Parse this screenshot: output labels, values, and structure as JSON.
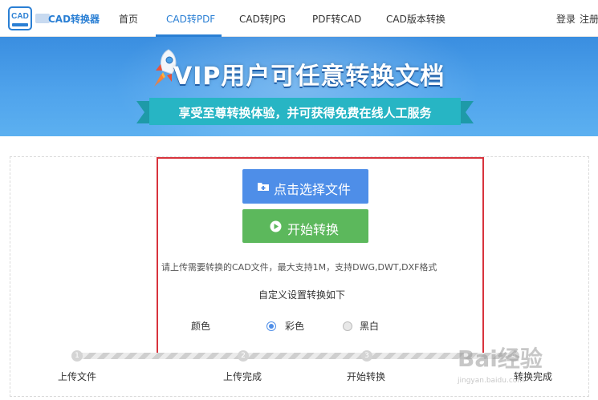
{
  "header": {
    "logo_icon_text": "CAD",
    "app_name": "CAD转换器",
    "nav": [
      {
        "label": "首页",
        "icon": "none"
      },
      {
        "label": "CAD转PDF",
        "active": true
      },
      {
        "label": "CAD转JPG"
      },
      {
        "label": "PDF转CAD"
      },
      {
        "label": "CAD版本转换"
      }
    ],
    "login": "登录",
    "register": "注册",
    "accent_color": "#2a7fd4"
  },
  "banner": {
    "title": "VIP用户可任意转换文档",
    "subtitle": "享受至尊转换体验，并可获得免费在线人工服务",
    "icon": "rocket-icon"
  },
  "upload": {
    "select_button": "点击选择文件",
    "select_icon": "folder-plus-icon",
    "convert_button": "开始转换",
    "convert_icon": "play-circle-icon",
    "hint": "请上传需要转换的CAD文件，最大支持1M，支持DWG,DWT,DXF格式",
    "settings_title": "自定义设置转换如下",
    "color_label": "颜色",
    "options": [
      {
        "label": "彩色",
        "checked": true
      },
      {
        "label": "黑白",
        "checked": false
      }
    ]
  },
  "steps": [
    {
      "num": "1",
      "label": "上传文件"
    },
    {
      "num": "2",
      "label": "上传完成"
    },
    {
      "num": "3",
      "label": "开始转换"
    },
    {
      "num": "4",
      "label": "转换完成"
    }
  ],
  "watermark": {
    "text": "Bai经验",
    "sub": "jingyan.baidu.com"
  },
  "colors": {
    "select_button": "#4e8ee8",
    "convert_button": "#5cb85c",
    "highlight_border": "#d8343d"
  }
}
